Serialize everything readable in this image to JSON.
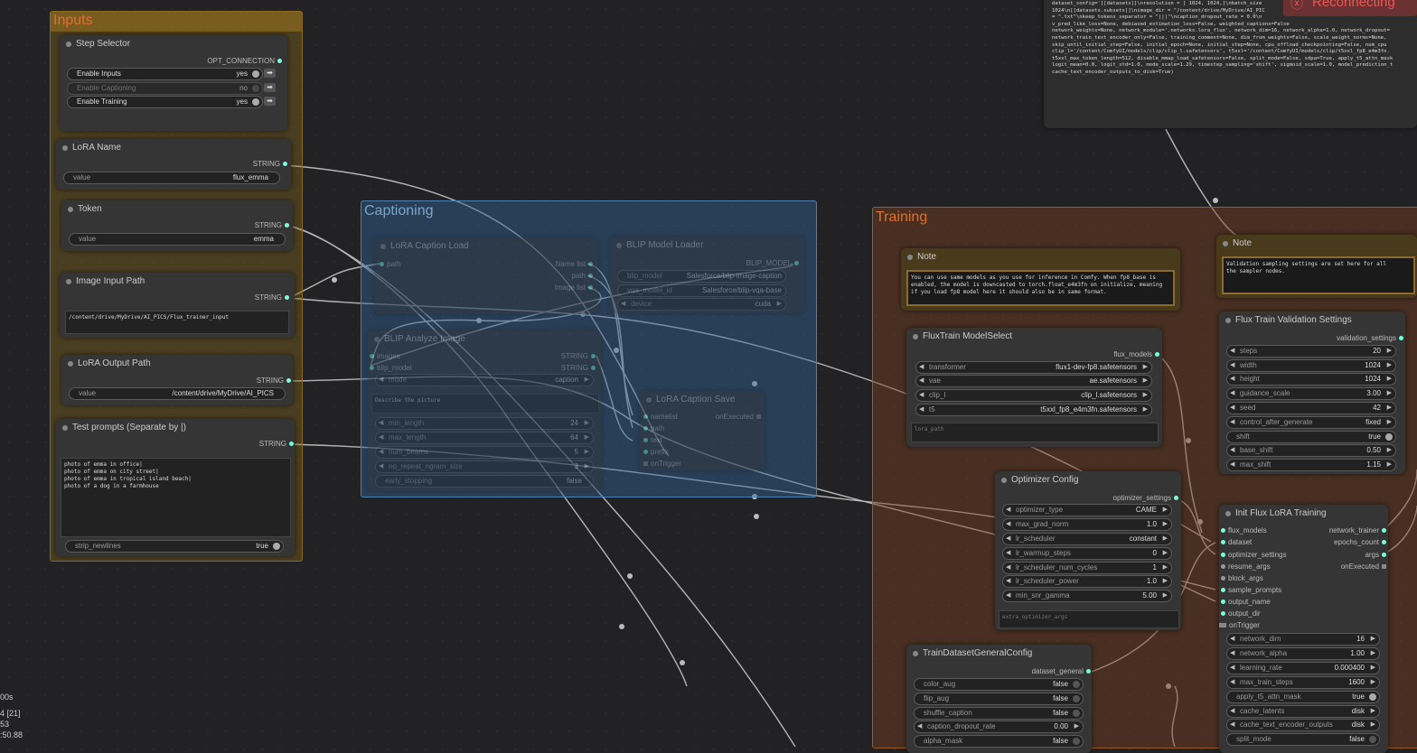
{
  "groups": {
    "inputs": "Inputs",
    "captioning": "Captioning",
    "training": "Training"
  },
  "step_selector": {
    "title": "Step Selector",
    "output": "OPT_CONNECTION",
    "rows": [
      {
        "label": "Enable Inputs",
        "value": "yes"
      },
      {
        "label": "Enable Captioning",
        "value": "no"
      },
      {
        "label": "Enable Training",
        "value": "yes"
      }
    ]
  },
  "lora_name": {
    "title": "LoRA Name",
    "output": "STRING",
    "label": "value",
    "value": "flux_emma"
  },
  "token": {
    "title": "Token",
    "output": "STRING",
    "label": "value",
    "value": "emma"
  },
  "image_input_path": {
    "title": "Image Input Path",
    "output": "STRING",
    "text": "/content/drive/MyDrive/AI_PICS/Flux_trainer_input"
  },
  "lora_output_path": {
    "title": "LoRA Output Path",
    "output": "STRING",
    "label": "value",
    "value": "/content/drive/MyDrive/AI_PICS"
  },
  "test_prompts": {
    "title": "Test prompts (Separate by |)",
    "output": "STRING",
    "text": "photo of emma in office|\nphoto of emma on city street|\nphoto of emma in tropical island beach|\nphoto of a dog in a farmhouse",
    "toggle_label": "strip_newlines",
    "toggle_value": "true"
  },
  "caption_load": {
    "title": "LoRA Caption Load",
    "in_path": "path",
    "outputs": [
      "Name list",
      "path",
      "Image list"
    ]
  },
  "blip_loader": {
    "title": "BLIP Model Loader",
    "output": "BLIP_MODEL",
    "rows": [
      {
        "label": "blip_model",
        "value": "Salesforce/blip-image-caption"
      },
      {
        "label": "vqa_model_id",
        "value": "Salesforce/blip-vqa-base"
      },
      {
        "label": "device",
        "value": "cuda"
      }
    ]
  },
  "blip_analyze": {
    "title": "BLIP Analyze Image",
    "inputs": [
      "images",
      "blip_model"
    ],
    "outputs": [
      "STRING",
      "STRING"
    ],
    "mode_label": "mode",
    "mode_value": "caption",
    "prompt": "Describe the picture",
    "rows": [
      {
        "label": "min_length",
        "value": "24"
      },
      {
        "label": "max_length",
        "value": "64"
      },
      {
        "label": "num_beams",
        "value": "5"
      },
      {
        "label": "no_repeat_ngram_size",
        "value": "3"
      },
      {
        "label": "early_stopping",
        "value": "false"
      }
    ]
  },
  "caption_save": {
    "title": "LoRA Caption Save",
    "inputs": [
      "namelist",
      "path",
      "text",
      "prefix"
    ],
    "output": "onExecuted",
    "trigger": "onTrigger"
  },
  "top_log": {
    "lines": "dataset_config='[[datasets]]\\nresolution = [ 1024, 1024,]\\nbatch_size\n1024\\n[[datasets.subsets]]\\nimage_dir = \"/content/drive/MyDrive/AI_PIC\n= \".txt\"\\nkeep_tokens_separator = \"|||\"\\ncaption_dropout_rate = 0.0\\n\nv_pred_like_loss=None, debiased_estimation_loss=False, weighted_captions=False\nnetwork_weights=None, network_module='.networks.lora_flux', network_dim=16, network_alpha=1.0, network_dropout=\nnetwork_train_text_encoder_only=False, training_comment=None, dim_from_weights=False, scale_weight_norms=None,\nskip_until_initial_step=False, initial_epoch=None, initial_step=None, cpu_offload_checkpointing=False, num_cpu\nclip_l='/content/ComfyUI/models/clip/clip_l.safetensors', t5xxl='/content/ComfyUI/models/clip/t5xxl_fp8_e4m3fn.\nt5xxl_max_token_length=512, disable_mmap_load_safetensors=False, split_mode=False, sdpa=True, apply_t5_attn_mask\nlogit_mean=0.0, logit_std=1.0, mode_scale=1.29, timestep_sampling='shift', sigmoid_scale=1.0, model_prediction_t\ncache_text_encoder_outputs_to_disk=True)",
    "reconnecting": "Reconnecting"
  },
  "note1": {
    "title": "Note",
    "text": "You can use same models as you use for inference in Comfy. When fp8_base is\nenabled, the model is downcasted to torch.float_e4m3fn on initialize, meaning\nif you load fp8 model here it should also be in same format."
  },
  "note2": {
    "title": "Note",
    "text": "Validation sampling settings are set here for all\nthe sampler nodes."
  },
  "model_select": {
    "title": "FluxTrain ModelSelect",
    "output": "flux_models",
    "rows": [
      {
        "label": "transformer",
        "value": "flux1-dev-fp8.safetensors"
      },
      {
        "label": "vae",
        "value": "ae.safetensors"
      },
      {
        "label": "clip_l",
        "value": "clip_l.safetensors"
      },
      {
        "label": "t5",
        "value": "t5xxl_fp8_e4m3fn.safetensors"
      }
    ],
    "placeholder": "lora_path"
  },
  "optimizer": {
    "title": "Optimizer Config",
    "output": "optimizer_settings",
    "rows": [
      {
        "label": "optimizer_type",
        "value": "CAME"
      },
      {
        "label": "max_grad_norm",
        "value": "1.0"
      },
      {
        "label": "lr_scheduler",
        "value": "constant"
      },
      {
        "label": "lr_warmup_steps",
        "value": "0"
      },
      {
        "label": "lr_scheduler_num_cycles",
        "value": "1"
      },
      {
        "label": "lr_scheduler_power",
        "value": "1.0"
      },
      {
        "label": "min_snr_gamma",
        "value": "5.00"
      }
    ],
    "placeholder": "extra_optimizer_args"
  },
  "dataset_cfg": {
    "title": "TrainDatasetGeneralConfig",
    "output": "dataset_general",
    "rows": [
      {
        "label": "color_aug",
        "value": "false",
        "kind": "toggle"
      },
      {
        "label": "flip_aug",
        "value": "false",
        "kind": "toggle"
      },
      {
        "label": "shuffle_caption",
        "value": "false",
        "kind": "toggle"
      },
      {
        "label": "caption_dropout_rate",
        "value": "0.00",
        "kind": "num"
      },
      {
        "label": "alpha_mask",
        "value": "false",
        "kind": "toggle"
      }
    ]
  },
  "validation": {
    "title": "Flux Train Validation Settings",
    "output": "validation_settings",
    "rows": [
      {
        "label": "steps",
        "value": "20",
        "kind": "num"
      },
      {
        "label": "width",
        "value": "1024",
        "kind": "num"
      },
      {
        "label": "height",
        "value": "1024",
        "kind": "num"
      },
      {
        "label": "guidance_scale",
        "value": "3.00",
        "kind": "num"
      },
      {
        "label": "seed",
        "value": "42",
        "kind": "num"
      },
      {
        "label": "control_after_generate",
        "value": "fixed",
        "kind": "num"
      },
      {
        "label": "shift",
        "value": "true",
        "kind": "toggle"
      },
      {
        "label": "base_shift",
        "value": "0.50",
        "kind": "num"
      },
      {
        "label": "max_shift",
        "value": "1.15",
        "kind": "num"
      }
    ]
  },
  "init_train": {
    "title": "Init Flux LoRA Training",
    "inputs": [
      "flux_models",
      "dataset",
      "optimizer_settings",
      "resume_args",
      "block_args",
      "sample_prompts",
      "output_name",
      "output_dir"
    ],
    "outputs": [
      "network_trainer",
      "epochs_count",
      "args",
      "onExecuted"
    ],
    "trigger": "onTrigger",
    "rows": [
      {
        "label": "network_dim",
        "value": "16",
        "kind": "num"
      },
      {
        "label": "network_alpha",
        "value": "1.00",
        "kind": "num"
      },
      {
        "label": "learning_rate",
        "value": "0.000400",
        "kind": "num"
      },
      {
        "label": "max_train_steps",
        "value": "1600",
        "kind": "num"
      },
      {
        "label": "apply_t5_attn_mask",
        "value": "true",
        "kind": "toggle"
      },
      {
        "label": "cache_latents",
        "value": "disk",
        "kind": "num"
      },
      {
        "label": "cache_text_encoder_outputs",
        "value": "disk",
        "kind": "num"
      },
      {
        "label": "split_mode",
        "value": "false",
        "kind": "toggle"
      }
    ]
  },
  "stats": {
    "lines": [
      "00s",
      "",
      "4 [21]",
      "53",
      ":50.88"
    ]
  }
}
